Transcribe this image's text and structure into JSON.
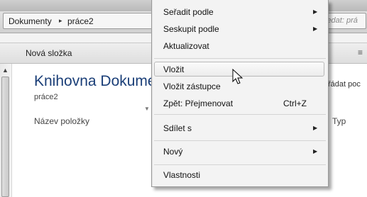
{
  "breadcrumb": {
    "item1": "Dokumenty",
    "item2": "práce2",
    "separator": "▸"
  },
  "search": {
    "placeholder": "ledat: prá"
  },
  "toolbar": {
    "new_folder": "Nová složka",
    "view_icon": "view-options-icon"
  },
  "library": {
    "title": "Knihovna Dokume",
    "subtitle": "práce2",
    "sort_by": "řádat poc"
  },
  "columns": {
    "name": "Název položky",
    "type": "Typ"
  },
  "context_menu": {
    "sort_by": "Seřadit podle",
    "group_by": "Seskupit podle",
    "refresh": "Aktualizovat",
    "paste": "Vložit",
    "paste_shortcut": "Vložit zástupce",
    "undo": "Zpět: Přejmenovat",
    "undo_key": "Ctrl+Z",
    "share": "Sdílet s",
    "new": "Nový",
    "properties": "Vlastnosti",
    "submenu_arrow": "▶",
    "highlighted": "Vložit"
  },
  "colors": {
    "library_title": "#1b3f78",
    "menu_bg": "#f3f3f3",
    "highlight_border": "#b9b9b9"
  }
}
